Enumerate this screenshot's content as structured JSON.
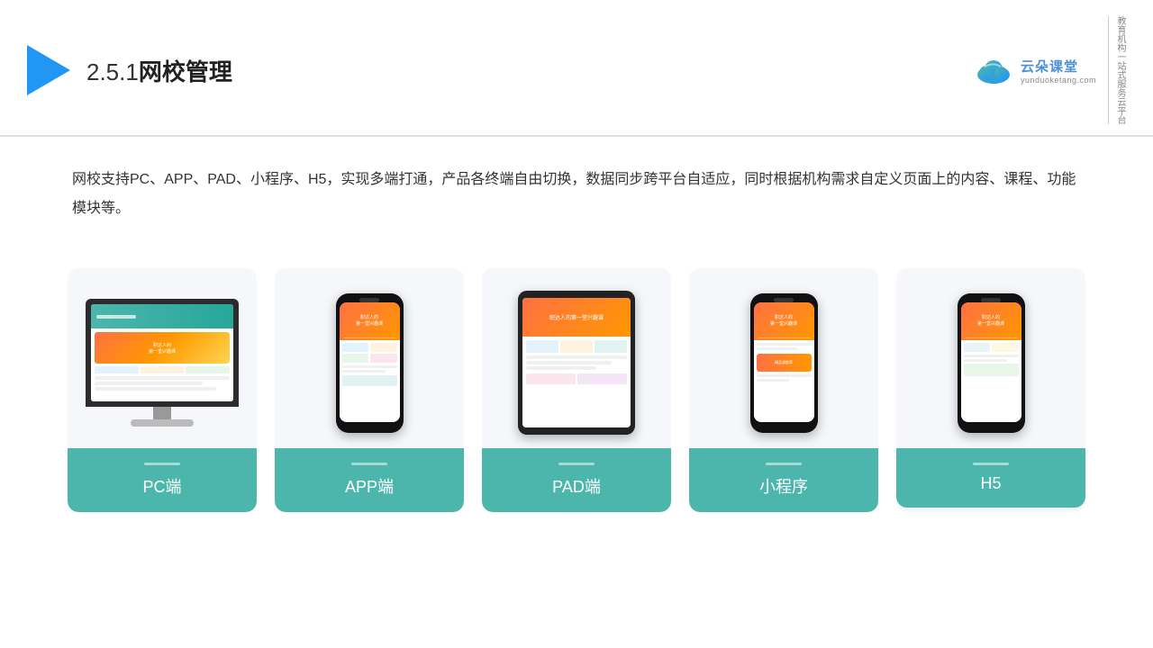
{
  "header": {
    "title": "网校管理",
    "section_number": "2.5.1",
    "brand": {
      "name": "云朵课堂",
      "url": "yunduoketang.com",
      "slogan": "教育机构一站式服务云平台"
    }
  },
  "description": {
    "text": "网校支持PC、APP、PAD、小程序、H5，实现多端打通，产品各终端自由切换，数据同步跨平台自适应，同时根据机构需求自定义页面上的内容、课程、功能模块等。"
  },
  "cards": [
    {
      "id": "pc",
      "label": "PC端"
    },
    {
      "id": "app",
      "label": "APP端"
    },
    {
      "id": "pad",
      "label": "PAD端"
    },
    {
      "id": "miniprogram",
      "label": "小程序"
    },
    {
      "id": "h5",
      "label": "H5"
    }
  ],
  "accent_color": "#4db6ac"
}
